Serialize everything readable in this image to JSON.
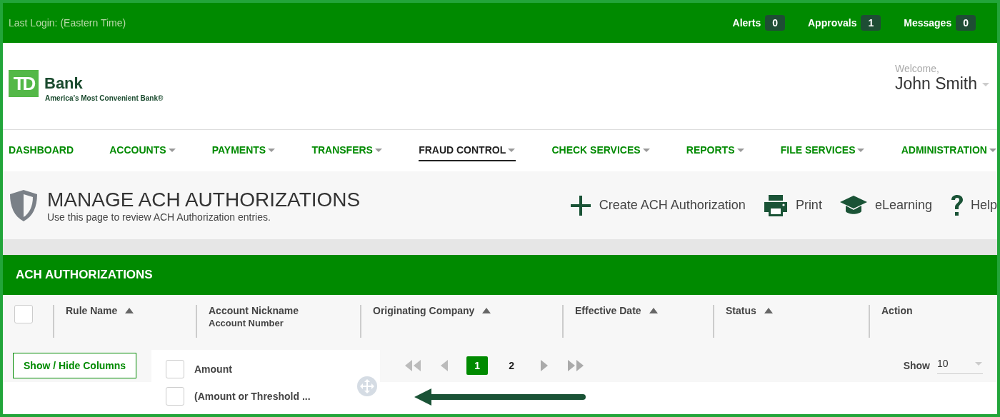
{
  "top_bar": {
    "last_login": "Last Login: (Eastern Time)",
    "counters": [
      {
        "label": "Alerts",
        "count": "0"
      },
      {
        "label": "Approvals",
        "count": "1"
      },
      {
        "label": "Messages",
        "count": "0"
      }
    ]
  },
  "header": {
    "logo": {
      "mark": "TD",
      "name": "Bank",
      "tagline": "America’s Most Convenient Bank®"
    },
    "welcome": "Welcome,",
    "user_name": "John Smith"
  },
  "nav": [
    {
      "label": "DASHBOARD",
      "selected": false,
      "dropdown": false
    },
    {
      "label": "ACCOUNTS",
      "selected": false,
      "dropdown": true
    },
    {
      "label": "PAYMENTS",
      "selected": false,
      "dropdown": true
    },
    {
      "label": "TRANSFERS",
      "selected": false,
      "dropdown": true
    },
    {
      "label": "FRAUD CONTROL",
      "selected": true,
      "dropdown": true
    },
    {
      "label": "CHECK SERVICES",
      "selected": false,
      "dropdown": true
    },
    {
      "label": "REPORTS",
      "selected": false,
      "dropdown": true
    },
    {
      "label": "FILE SERVICES",
      "selected": false,
      "dropdown": true
    },
    {
      "label": "ADMINISTRATION",
      "selected": false,
      "dropdown": true
    }
  ],
  "page_header": {
    "title": "MANAGE ACH AUTHORIZATIONS",
    "subtitle": "Use this page to review ACH Authorization entries.",
    "actions": [
      {
        "kind": "create",
        "label": "Create ACH Authorization"
      },
      {
        "kind": "print",
        "label": "Print"
      },
      {
        "kind": "elearning",
        "label": "eLearning"
      },
      {
        "kind": "help",
        "label": "Help"
      }
    ]
  },
  "panel": {
    "title": "ACH AUTHORIZATIONS",
    "select_all_checked": false,
    "columns": [
      {
        "label": "Rule Name",
        "sortable": true
      },
      {
        "label": "Account Nickname",
        "sublabel": "Account Number",
        "sortable": false
      },
      {
        "label": "Originating Company",
        "sortable": true
      },
      {
        "label": "Effective Date",
        "sortable": true
      },
      {
        "label": "Status",
        "sortable": true
      },
      {
        "label": "Action",
        "sortable": false
      }
    ],
    "show_hide_button": "Show / Hide Columns",
    "column_options": [
      {
        "label": "Amount",
        "checked": false
      },
      {
        "label": "(Amount or Threshold ...",
        "checked": false
      }
    ],
    "pagination": {
      "pages": [
        {
          "label": "1",
          "selected": true
        },
        {
          "label": "2",
          "selected": false
        }
      ]
    },
    "page_size": {
      "label": "Show",
      "value": "10"
    }
  }
}
